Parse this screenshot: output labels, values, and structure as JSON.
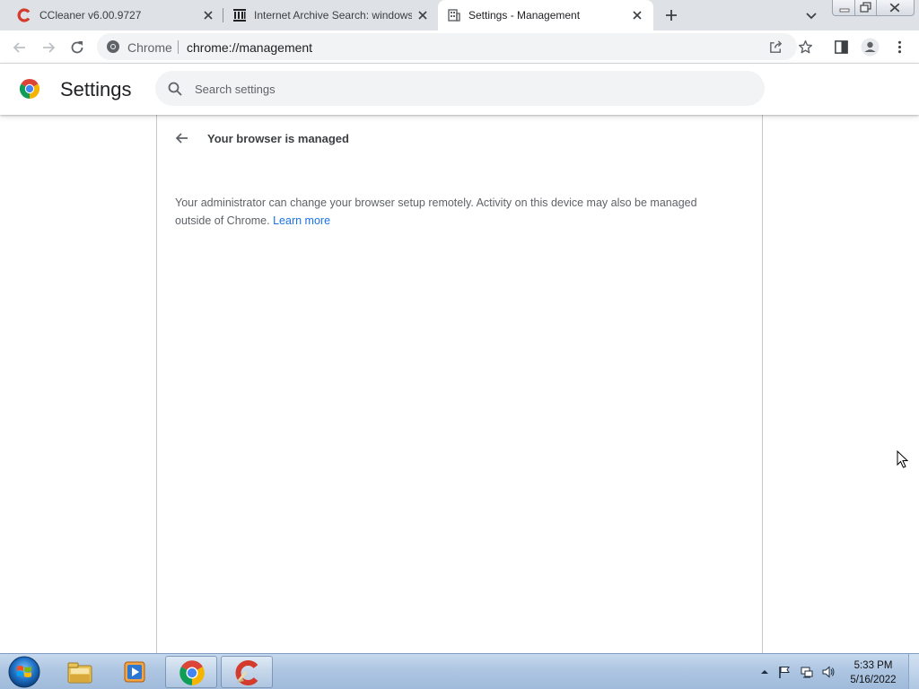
{
  "browser": {
    "tabs": [
      {
        "title": "CCleaner v6.00.9727",
        "favicon": "ccleaner-icon",
        "active": false
      },
      {
        "title": "Internet Archive Search: windows",
        "favicon": "archive-icon",
        "active": false
      },
      {
        "title": "Settings - Management",
        "favicon": "settings-page-icon",
        "active": true
      }
    ],
    "omnibox": {
      "site_chip": "Chrome",
      "url": "chrome://management"
    }
  },
  "settings": {
    "title": "Settings",
    "search_placeholder": "Search settings",
    "subpage_title": "Your browser is managed",
    "managed_message": "Your administrator can change your browser setup remotely. Activity on this device may also be managed outside of Chrome.",
    "learn_more": "Learn more"
  },
  "taskbar": {
    "pinned": [
      "windows-explorer-icon",
      "media-player-icon",
      "chrome-icon",
      "ccleaner-icon"
    ],
    "clock_time": "5:33 PM",
    "clock_date": "5/16/2022"
  },
  "colors": {
    "accent_link": "#1a73e8",
    "tabstrip_bg": "#dee1e6",
    "omnibox_bg": "#f1f3f4"
  }
}
